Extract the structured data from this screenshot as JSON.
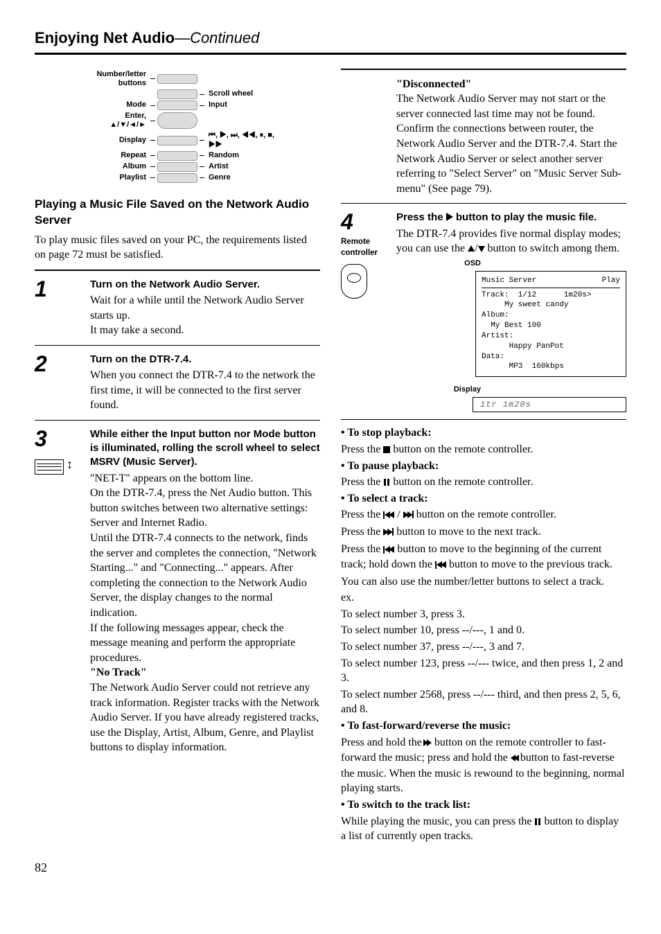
{
  "header": {
    "main": "Enjoying Net Audio",
    "sub": "—Continued"
  },
  "diagram": {
    "left": {
      "number_letter": "Number/letter buttons",
      "mode": "Mode",
      "enter": "Enter,",
      "arrows": "▲/▼/◄/►",
      "display": "Display",
      "repeat": "Repeat",
      "album": "Album",
      "playlist": "Playlist"
    },
    "right": {
      "scroll": "Scroll wheel",
      "input": "Input",
      "transport": "⏮, ▶, ⏭, ◀◀, ⏸, ■, ▶▶",
      "random": "Random",
      "artist": "Artist",
      "genre": "Genre"
    }
  },
  "section1": {
    "title": "Playing a Music File Saved on the Network Audio Server",
    "intro": "To play music files saved on your PC, the requirements listed on page 72 must be satisfied."
  },
  "steps": {
    "s1": {
      "num": "1",
      "head": "Turn on the Network Audio Server.",
      "b1": "Wait for a while until the Network Audio Server starts up.",
      "b2": "It may take a second."
    },
    "s2": {
      "num": "2",
      "head": "Turn on the DTR-7.4.",
      "b1": "When you connect the DTR-7.4 to the network the first time, it will be connected to the first server found."
    },
    "s3": {
      "num": "3",
      "head": "While either the Input button nor Mode button is illuminated, rolling the scroll wheel to select MSRV (Music Server).",
      "b1": "\"NET-T\" appears on the bottom line.",
      "b2": "On the DTR-7.4, press the Net Audio button. This button switches between two alternative settings: Server and Internet Radio.",
      "b3": "Until the DTR-7.4 connects to the network, finds the server and completes the connection, \"Network Starting...\" and \"Connecting...\" appears. After completing the connection to the Network Audio Server, the display changes to the normal indication.",
      "b4": "If the following messages appear, check the message meaning and perform the appropriate procedures.",
      "no_track_head": "\"No Track\"",
      "no_track_body": "The Network Audio Server could not retrieve any track information. Register tracks with the Network Audio Server. If you have already registered tracks, use the Display, Artist, Album, Genre, and Playlist buttons to display information."
    },
    "s4": {
      "num": "4",
      "side": "Remote controller",
      "head": "Press the ▶ button to play the music file.",
      "b1": "The DTR-7.4 provides five normal display modes; you can use the ",
      "b1_tail": " button to switch among them.",
      "osd_label": "OSD",
      "disp_label": "Display"
    }
  },
  "disconnected": {
    "head": "\"Disconnected\"",
    "body": "The Network Audio Server may not start or the server connected last time may not be found. Confirm the connections between router, the Network Audio Server and the DTR-7.4. Start the Network Audio Server or select another server referring to \"Select Server\" on \"Music Server Sub-menu\" (See page 79)."
  },
  "osd": {
    "title": "Music Server",
    "play": "Play",
    "track": "Track:  1/12      1m20s>",
    "song": "     My sweet candy",
    "album_l": "Album:",
    "album": "  My Best 100",
    "artist_l": "Artist:",
    "artist": "      Happy PanPot",
    "data_l": "Data:",
    "data": "      MP3  160kbps"
  },
  "disp_text": "1tr   1m20s",
  "bullets": {
    "stop_h": "To stop playback:",
    "stop_b1a": "Press the ",
    "stop_b1b": " button on the remote controller.",
    "pause_h": "To pause playback:",
    "pause_b1a": "Press the ",
    "pause_b1b": " button on the remote controller.",
    "sel_h": "To select a track:",
    "sel_b1a": "Press the ",
    "sel_b1b": " button on the remote controller.",
    "sel_b2a": "Press the ",
    "sel_b2b": " button to move to the next track.",
    "sel_b3a": "Press the ",
    "sel_b3b": " button to move to the beginning of the current track; hold down the ",
    "sel_b3c": " button to move to the previous track.",
    "sel_b4": "You can also use the number/letter buttons to select a track.",
    "sel_ex": "ex.",
    "sel_e1": "To select number 3, press 3.",
    "sel_e2": "To select number 10, press --/---, 1 and 0.",
    "sel_e3": "To select number 37, press --/---, 3 and 7.",
    "sel_e4": "To select number 123, press --/--- twice, and then press 1, 2 and 3.",
    "sel_e5": "To select number 2568, press --/--- third, and then press 2, 5, 6, and 8.",
    "ff_h": "To fast-forward/reverse the music:",
    "ff_b1a": "Press and hold the ",
    "ff_b1b": " button on the remote controller to fast-forward the music; press and hold the ",
    "ff_b1c": " button to fast-reverse the music. When the music is rewound to the beginning, normal playing starts.",
    "sw_h": "To switch to the track list:",
    "sw_b1a": "While playing the music, you can press the ",
    "sw_b1b": " button to display a list of currently open tracks."
  },
  "page": "82"
}
